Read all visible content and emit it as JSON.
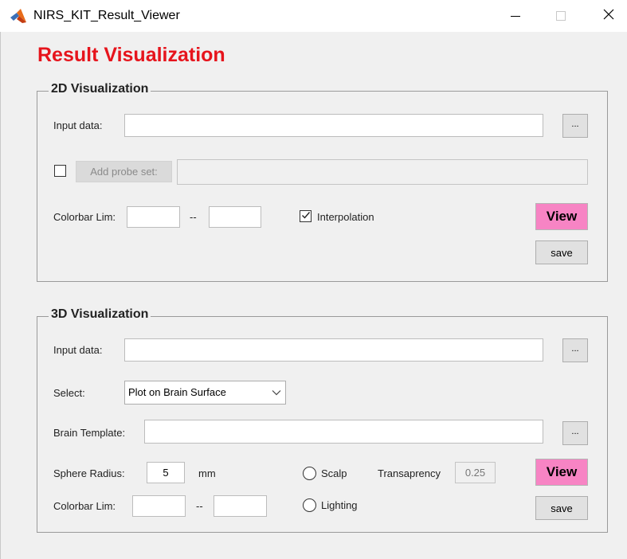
{
  "window": {
    "title": "NIRS_KIT_Result_Viewer",
    "icon": "matlab-icon",
    "controls": {
      "minimize": "minimize-icon",
      "maximize": "maximize-icon",
      "close": "×"
    }
  },
  "heading": "Result Visualization",
  "colors": {
    "heading": "#e6141c",
    "view_button": "#f784c4",
    "panel_bg": "#f0f0f0"
  },
  "panel_2d": {
    "title": "2D Visualization",
    "input_label": "Input data:",
    "input_value": "",
    "browse_label": "...",
    "probe_checkbox_checked": false,
    "probe_button_label": "Add probe set:",
    "probe_value": "",
    "colorbar_label": "Colorbar Lim:",
    "colorbar_min": "",
    "colorbar_sep": "--",
    "colorbar_max": "",
    "interpolation_checked": true,
    "interpolation_label": "Interpolation",
    "view_label": "View",
    "save_label": "save"
  },
  "panel_3d": {
    "title": "3D Visualization",
    "input_label": "Input data:",
    "input_value": "",
    "browse_label": "...",
    "select_label": "Select:",
    "select_value": "Plot on Brain Surface",
    "template_label": "Brain Template:",
    "template_value": "",
    "template_browse_label": "...",
    "radius_label": "Sphere Radius:",
    "radius_value": "5",
    "radius_unit": "mm",
    "scalp_label": "Scalp",
    "scalp_selected": false,
    "transparency_label": "Transaprency",
    "transparency_value": "0.25",
    "view_label": "View",
    "colorbar_label": "Colorbar Lim:",
    "colorbar_min": "",
    "colorbar_sep": "--",
    "colorbar_max": "",
    "lighting_label": "Lighting",
    "lighting_selected": false,
    "save_label": "save"
  }
}
